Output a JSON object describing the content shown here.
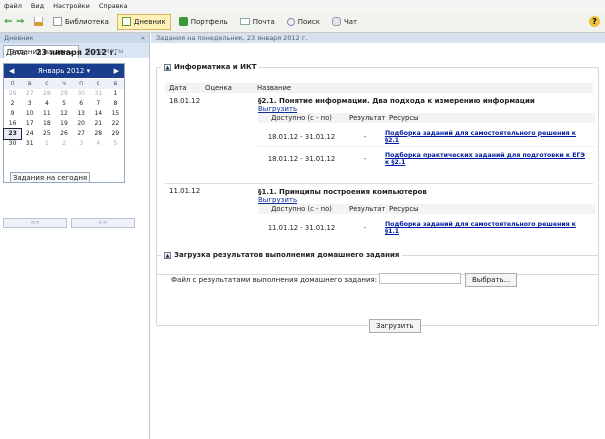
{
  "menu": [
    "файл",
    "Вид",
    "Настройки",
    "Справка"
  ],
  "toolbar": {
    "library": "Библиотека",
    "diary": "Дневник",
    "portfolio": "Портфель",
    "mail": "Почта",
    "search": "Поиск",
    "chat": "Чат"
  },
  "left": {
    "header": "Дневник",
    "tab_active": "Задания на день",
    "tab_other": "Предметы",
    "date_label": "Дата:",
    "date_value": "23 января 2012 г.",
    "month": "Январь 2012",
    "days": [
      "п",
      "в",
      "с",
      "ч",
      "п",
      "с",
      "в"
    ],
    "today": "Задания на сегодня",
    "prev": "<<",
    "next": ">>"
  },
  "main": {
    "breadcrumb": "Задания на понедельник, 23 января 2012 г.",
    "subject": "Информатика и ИКТ",
    "col_date": "Дата",
    "col_grade": "Оценка",
    "col_name": "Название",
    "lessons": [
      {
        "date": "18.01.12",
        "title": "§2.1. Понятие информации. Два подхода к измерению информации",
        "download": "Выгрузить",
        "items": [
          {
            "period": "18.01.12 - 31.01.12",
            "result": "-",
            "resource": "Подборка заданий для самостоятельного решения к §2.1"
          },
          {
            "period": "18.01.12 - 31.01.12",
            "result": "-",
            "resource": "Подборка практических заданий для подготовки к ЕГЭ к §2.1"
          }
        ]
      },
      {
        "date": "11.01.12",
        "title": "§1.1. Принципы построения компьютеров",
        "download": "Выгрузить",
        "items": [
          {
            "period": "11.01.12 - 31.01.12",
            "result": "-",
            "resource": "Подборка заданий для самостоятельного решения к §1.1"
          }
        ]
      }
    ],
    "sub_headers": {
      "available": "Доступно (с - по)",
      "result": "Результат",
      "resources": "Ресурсы"
    },
    "upload": {
      "title": "Загрузка результатов выполнения домашнего задания",
      "label": "Файл с результатами выполнения домашнего задания:",
      "choose": "Выбрать...",
      "submit": "Загрузить"
    }
  }
}
